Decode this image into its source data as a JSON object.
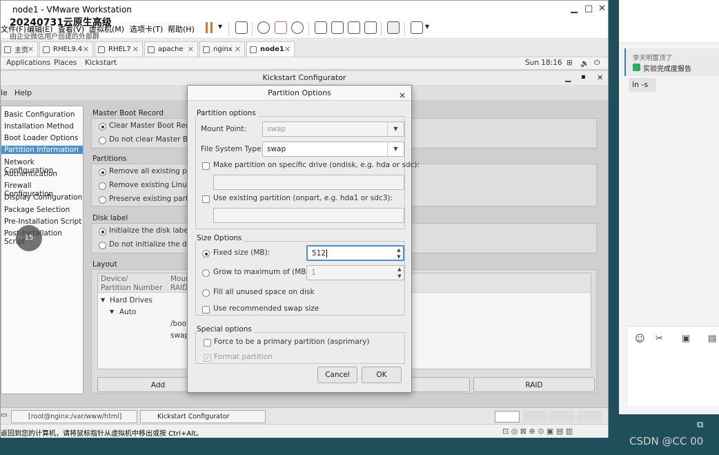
{
  "window": {
    "title": "node1 - VMware Workstation",
    "minimize": "▁",
    "maximize": "□",
    "close": "✕"
  },
  "menu": [
    "文件(F)",
    "编辑(E)",
    "查看(V)",
    "虚拟机(M)",
    "选项卡(T)",
    "帮助(H)"
  ],
  "tabs": [
    {
      "label": "主页",
      "active": false
    },
    {
      "label": "RHEL9.4",
      "active": false
    },
    {
      "label": "RHEL7",
      "active": false
    },
    {
      "label": "apache",
      "active": false
    },
    {
      "label": "nginx",
      "active": false
    },
    {
      "label": "node1",
      "active": true
    }
  ],
  "gnome": {
    "applications": "Applications",
    "places": "Places",
    "app": "Kickstart",
    "clock": "Sun 18:16"
  },
  "kickstart": {
    "title": "Kickstart Configurator",
    "menu_file": "le",
    "menu_help": "Help",
    "nav": [
      "Basic Configuration",
      "Installation Method",
      "Boot Loader Options",
      "Partition Information",
      "Network Configuration",
      "Authentication",
      "Firewall Configuration",
      "Display Configuration",
      "Package Selection",
      "Pre-Installation Script",
      "Post-Installation Script"
    ],
    "selected_nav": "Partition Information",
    "mbr": {
      "title": "Master Boot Record",
      "opt1": "Clear Master Boot Record",
      "opt2": "Do not clear Master Boot"
    },
    "partitions": {
      "title": "Partitions",
      "opt1": "Remove all existing partiti",
      "opt2": "Remove existing Linux par",
      "opt3": "Preserve existing partition"
    },
    "disklabel": {
      "title": "Disk label",
      "opt1": "Initialize the disk label",
      "opt2": "Do not initialize the disk la"
    },
    "layout": {
      "title": "Layout",
      "col1a": "Device/",
      "col1b": "Partition Number",
      "col2a": "Moun",
      "col2b": "RAID",
      "hard_drives": "Hard Drives",
      "auto": "Auto",
      "boot": "/boot",
      "swap": "swap"
    },
    "buttons": {
      "add": "Add",
      "edit_partial": "te",
      "raid": "RAID"
    }
  },
  "dialog": {
    "title": "Partition Options",
    "close": "×",
    "partition_options": {
      "title": "Partition options",
      "mount_label": "Mount Point:",
      "mount_value": "swap",
      "fstype_label": "File System Type:",
      "fstype_value": "swap",
      "ondisk_label": "Make partition on specific drive (ondisk, e.g. hda or sdc):",
      "ondisk_value": "",
      "onpart_label": "Use existing partition (onpart, e.g. hda1 or sdc3):",
      "onpart_value": ""
    },
    "size_options": {
      "title": "Size Options",
      "fixed_label": "Fixed size (MB):",
      "fixed_value": "512",
      "grow_label": "Grow to maximum of (MB):",
      "grow_value": "1",
      "fill_label": "Fill all unused space on disk",
      "recommended_label": "Use recommended swap size"
    },
    "special_options": {
      "title": "Special options",
      "primary_label": "Force to be a primary partition (asprimary)",
      "format_label": "Format partition"
    },
    "cancel": "Cancel",
    "ok": "OK"
  },
  "taskbar": {
    "terminal": "[root@nginx:/var/www/html]",
    "kickstart": "Kickstart Configurator"
  },
  "status_text": "返回到您的计算机，请将鼠标指针从虚拟机中移出或按 Ctrl+Alt。",
  "chat": {
    "title": "20240731云原生高级",
    "subtitle": "由企业微信用户创建的外部群",
    "quote_name": "李天明置顶了",
    "quote_doc": "实验完成度报告",
    "bubble": "ln -s"
  },
  "watermark": "CSDN @CC 00",
  "cursor_badge": "15"
}
